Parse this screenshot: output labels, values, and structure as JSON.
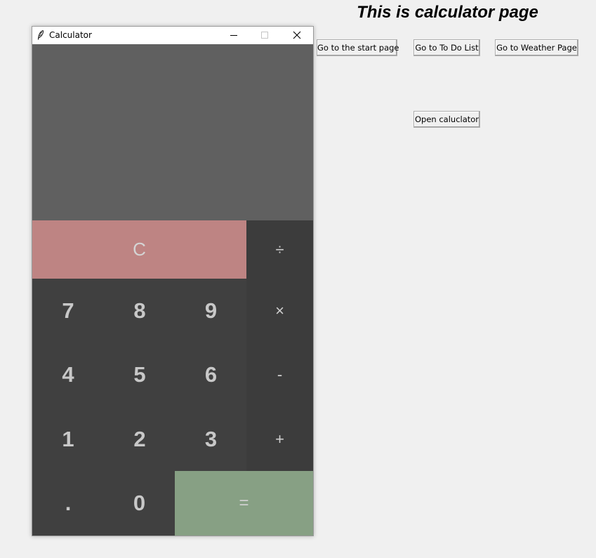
{
  "page": {
    "title": "This is calculator page",
    "buttons": {
      "start": "Go to the start page",
      "todo": "Go to To Do List",
      "weather": "Go to Weather Page",
      "open_calculator": "Open caluclator"
    }
  },
  "calculator_window": {
    "title": "Calculator",
    "icon": "feather-icon",
    "controls": {
      "minimize": "minimize-icon",
      "maximize": "maximize-icon",
      "close": "close-icon"
    },
    "display": {
      "value": ""
    },
    "keys": {
      "clear": "C",
      "divide": "÷",
      "multiply": "×",
      "subtract": "-",
      "add": "+",
      "equals": "=",
      "decimal": ".",
      "digits": [
        "0",
        "1",
        "2",
        "3",
        "4",
        "5",
        "6",
        "7",
        "8",
        "9"
      ]
    }
  },
  "colors": {
    "page_background": "#f0f0f0",
    "display_background": "#606060",
    "digit_key": "#404040",
    "operator_key": "#3c3c3c",
    "clear_key": "#be8483",
    "equals_key": "#87a084",
    "key_text": "#c8c8c8"
  }
}
